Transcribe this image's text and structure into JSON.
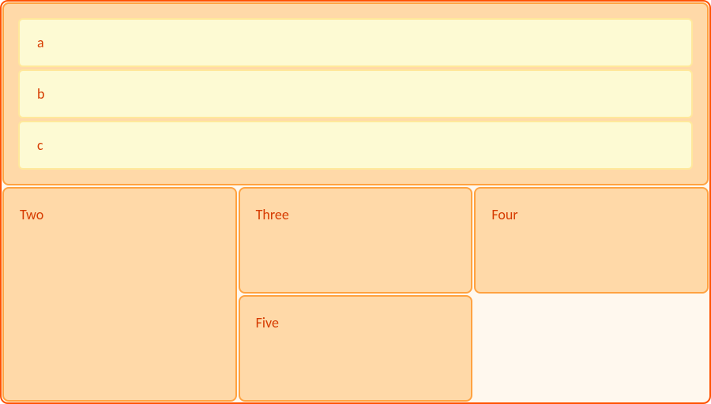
{
  "colors": {
    "page_bg": "#fff8ee",
    "cell_bg": "#ffd9a8",
    "cell_border": "#ffa240",
    "root_border": "#ff5200",
    "inner_bg": "#fdfad3",
    "inner_border": "#ffe89b",
    "text": "#d63b00"
  },
  "cells": {
    "one": {
      "items": [
        "a",
        "b",
        "c"
      ]
    },
    "two": {
      "label": "Two"
    },
    "three": {
      "label": "Three"
    },
    "four": {
      "label": "Four"
    },
    "five": {
      "label": "Five"
    }
  }
}
